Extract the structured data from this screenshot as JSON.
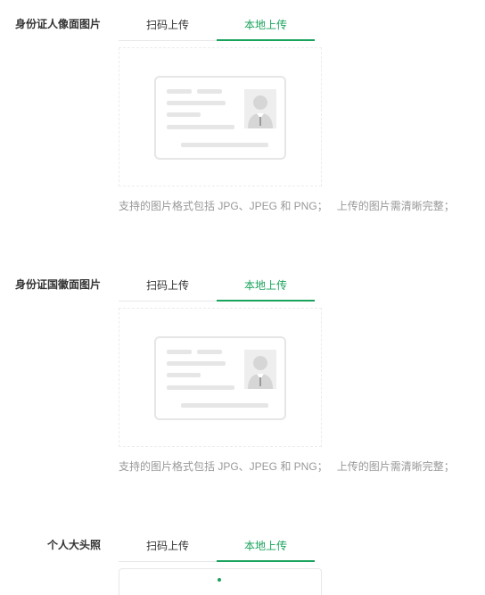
{
  "accent_color": "#1aa35c",
  "sections": [
    {
      "label": "身份证人像面图片",
      "tabs": [
        {
          "label": "扫码上传",
          "active": false
        },
        {
          "label": "本地上传",
          "active": true
        }
      ],
      "hint_formats": "支持的图片格式包括 JPG、JPEG 和 PNG；",
      "hint_quality": "上传的图片需清晰完整；"
    },
    {
      "label": "身份证国徽面图片",
      "tabs": [
        {
          "label": "扫码上传",
          "active": false
        },
        {
          "label": "本地上传",
          "active": true
        }
      ],
      "hint_formats": "支持的图片格式包括 JPG、JPEG 和 PNG；",
      "hint_quality": "上传的图片需清晰完整；"
    },
    {
      "label": "个人大头照",
      "tabs": [
        {
          "label": "扫码上传",
          "active": false
        },
        {
          "label": "本地上传",
          "active": true
        }
      ]
    }
  ]
}
